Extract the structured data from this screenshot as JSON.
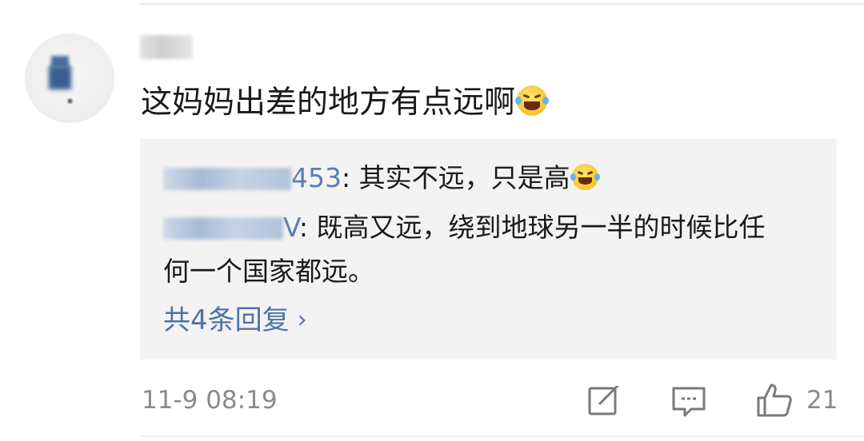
{
  "comment": {
    "text": "这妈妈出差的地方有点远啊",
    "emoji": "laughing-tears-emoji",
    "timestamp": "11-9 08:19",
    "like_count": "21"
  },
  "replies": [
    {
      "user_suffix": "453",
      "separator": ": ",
      "text": "其实不远，只是高",
      "emoji": "crying-laughing-emoji"
    },
    {
      "user_suffix": "V",
      "separator": ": ",
      "text_line1": "既高又远，绕到地球另一半的时候比任",
      "text_line2": "何一个国家都远。"
    }
  ],
  "more_replies_label": "共4条回复",
  "chevron": "›",
  "icons": {
    "share": "share-edit-icon",
    "comment": "comment-bubble-icon",
    "like": "thumbs-up-icon"
  },
  "colors": {
    "link_blue": "#4d72a8",
    "reply_bg": "#f3f3f3",
    "meta_gray": "#8a8a8a"
  }
}
